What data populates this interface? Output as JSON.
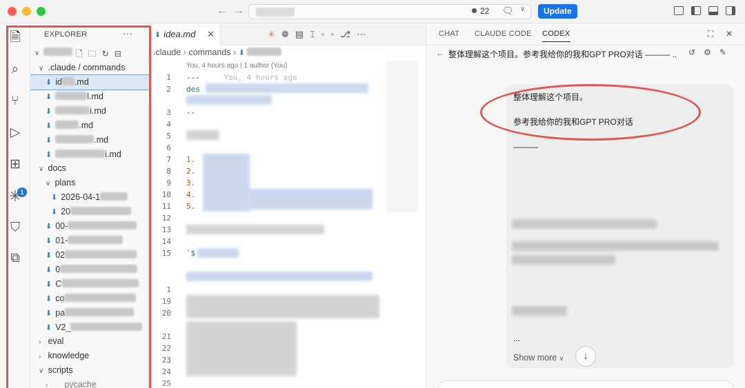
{
  "titlebar": {
    "back_glyph": "←",
    "forward_glyph": "→",
    "notification_count": "22",
    "update_label": "Update"
  },
  "activity_bar": {
    "items": [
      "explorer-icon",
      "search-icon",
      "source-control-icon",
      "run-debug-icon",
      "extensions-icon",
      "claude-icon",
      "bookmark-icon",
      "remote-icon"
    ],
    "extensions_badge": "1"
  },
  "explorer": {
    "title": "EXPLORER",
    "more": "···",
    "tree": [
      {
        "label": ".claude / commands",
        "kind": "folder",
        "open": true
      },
      {
        "label": ".md",
        "kind": "file",
        "selected": true
      },
      {
        "label": "l.md",
        "kind": "file"
      },
      {
        "label": "i.md",
        "kind": "file"
      },
      {
        "label": ".md",
        "kind": "file"
      },
      {
        "label": ".md",
        "kind": "file"
      },
      {
        "label": "i.md",
        "kind": "file"
      },
      {
        "label": "docs",
        "kind": "folder",
        "open": true
      },
      {
        "label": "plans",
        "kind": "folder",
        "open": true
      },
      {
        "label": "2026-04-1",
        "kind": "file"
      },
      {
        "label": "20",
        "kind": "file"
      },
      {
        "label": "00-",
        "kind": "file"
      },
      {
        "label": "01-",
        "kind": "file"
      },
      {
        "label": "02",
        "kind": "file"
      },
      {
        "label": "0",
        "kind": "file"
      },
      {
        "label": "C",
        "kind": "file"
      },
      {
        "label": "co",
        "kind": "file"
      },
      {
        "label": "pa",
        "kind": "file"
      },
      {
        "label": "V2_",
        "kind": "file"
      },
      {
        "label": "eval",
        "kind": "folder",
        "open": false
      },
      {
        "label": "knowledge",
        "kind": "folder",
        "open": false
      },
      {
        "label": "scripts",
        "kind": "folder",
        "open": true
      },
      {
        "label": "__pycache__",
        "kind": "folder",
        "open": false
      }
    ]
  },
  "editor": {
    "tab_label": "idea.md",
    "tab_close": "✕",
    "breadcrumb": [
      ".claude",
      "commands"
    ],
    "blame": "You, 4 hours ago | 1 author (You)",
    "line_numbers": [
      "1",
      "2",
      "3",
      "4",
      "5",
      "6",
      "7",
      "8",
      "9",
      "10",
      "11",
      "12",
      "13",
      "14",
      "15",
      "1",
      "19",
      "20",
      "21",
      "22",
      "23",
      "24",
      "25"
    ],
    "code_line_1": "---",
    "code_line_1_ghost": "You, 4 hours ago",
    "code_line_2_prefix": "des",
    "code_line_3": "--",
    "list_markers": [
      "1.",
      "2.",
      "3.",
      "4.",
      "5."
    ],
    "line_15_prefix": "`$"
  },
  "chat": {
    "tabs": [
      "CHAT",
      "CLAUDE CODE",
      "CODEX"
    ],
    "active_tab": "CODEX",
    "conversation_title": "整体理解这个项目。参考我给你的我和GPT PRO对话 ——— ...",
    "message_line_1": "整体理解这个项目。",
    "message_line_2": "参考我给你的我和GPT PRO对话",
    "message_line_3": "———",
    "message_ellipsis": "...",
    "show_more": "Show more",
    "colors": {
      "accent": "#1a72e8",
      "highlight_ring": "#e05555"
    }
  }
}
